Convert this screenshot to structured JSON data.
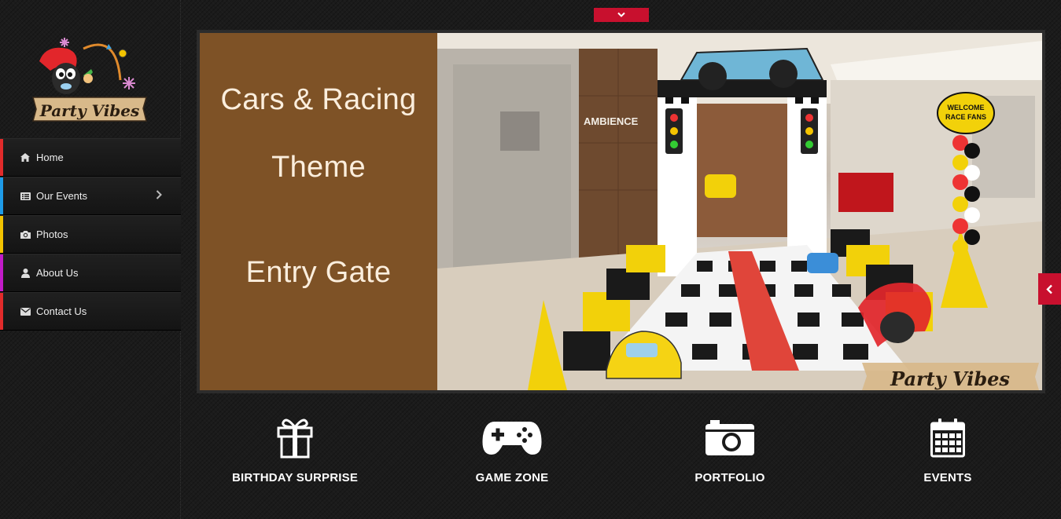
{
  "brand": {
    "logo_text": "Party Vibes"
  },
  "nav": {
    "items": [
      {
        "label": "Home",
        "icon": "home-icon",
        "color": "#e12b2b"
      },
      {
        "label": "Our Events",
        "icon": "list-icon",
        "color": "#1e9be8",
        "has_submenu": true
      },
      {
        "label": "Photos",
        "icon": "camera-icon",
        "color": "#f2c300"
      },
      {
        "label": "About Us",
        "icon": "user-icon",
        "color": "#c21bc9"
      },
      {
        "label": "Contact Us",
        "icon": "envelope-icon",
        "color": "#e12b2b"
      }
    ]
  },
  "slide": {
    "line1": "Cars & Racing",
    "line2": "Theme",
    "line3": "Entry Gate",
    "photo_sign_welcome": "WELCOME RACE FANS",
    "photo_sign_store": "AMBIENCE",
    "photo_watermark": "Party Vibes"
  },
  "features": [
    {
      "label": "BIRTHDAY SURPRISE",
      "icon": "gift-icon"
    },
    {
      "label": "GAME ZONE",
      "icon": "gamepad-icon"
    },
    {
      "label": "PORTFOLIO",
      "icon": "camera-icon"
    },
    {
      "label": "EVENTS",
      "icon": "calendar-icon"
    }
  ],
  "colors": {
    "accent": "#c8102e",
    "slide_panel": "#7e5226"
  }
}
